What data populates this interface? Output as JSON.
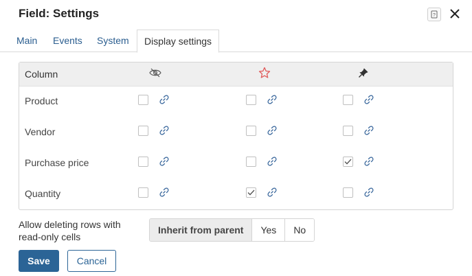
{
  "dialog": {
    "title": "Field: Settings"
  },
  "tabs": [
    {
      "label": "Main"
    },
    {
      "label": "Events"
    },
    {
      "label": "System"
    },
    {
      "label": "Display settings"
    }
  ],
  "active_tab": "Display settings",
  "grid": {
    "column_header": "Column",
    "column_icons": [
      "hidden-eye-icon",
      "star-icon",
      "pin-icon"
    ],
    "rows": [
      {
        "label": "Product",
        "checked": [
          false,
          false,
          false
        ]
      },
      {
        "label": "Vendor",
        "checked": [
          false,
          false,
          false
        ]
      },
      {
        "label": "Purchase price",
        "checked": [
          false,
          false,
          true
        ]
      },
      {
        "label": "Quantity",
        "checked": [
          false,
          true,
          false
        ]
      }
    ]
  },
  "delete_option": {
    "label": "Allow deleting rows with read-only cells",
    "options": [
      "Inherit from parent",
      "Yes",
      "No"
    ],
    "selected": "Inherit from parent"
  },
  "buttons": {
    "save": "Save",
    "cancel": "Cancel"
  },
  "colors": {
    "primary": "#2b6496",
    "link": "#2a5d8f",
    "star": "#e05a5a"
  }
}
